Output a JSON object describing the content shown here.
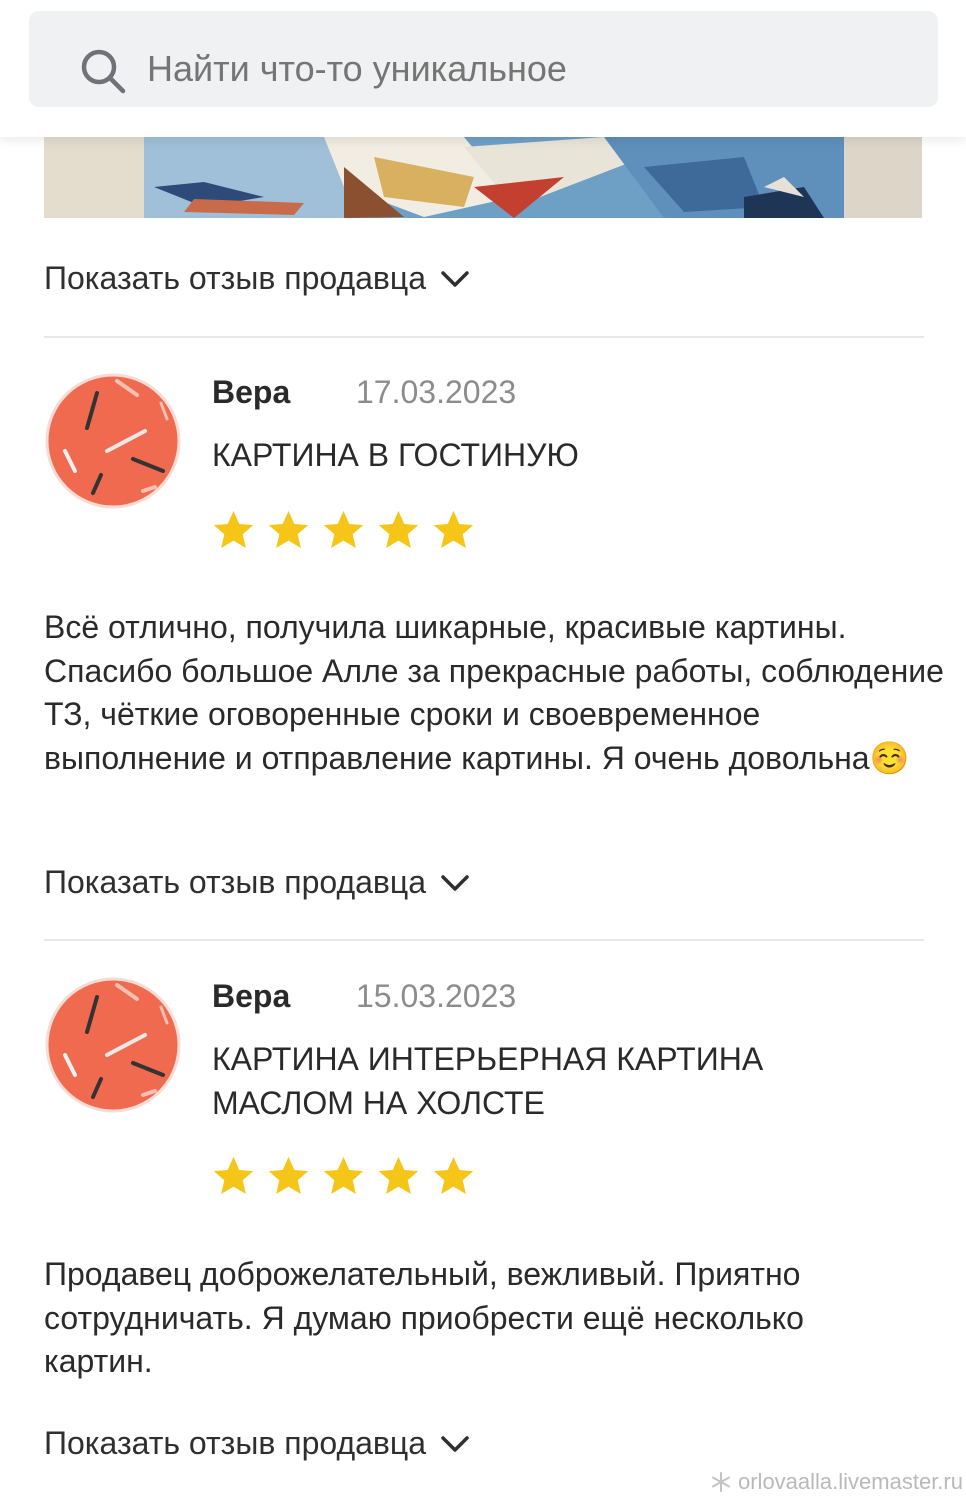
{
  "search": {
    "placeholder": "Найти что-то уникальное"
  },
  "show_seller_reply_label": "Показать отзыв продавца",
  "reviews": [
    {
      "author": "Вера",
      "date": "17.03.2023",
      "title": "КАРТИНА В ГОСТИНУЮ",
      "rating": 5,
      "text": "Всё отлично, получила шикарные, красивые картины. Спасибо большое Алле за прекрасные работы, соблюдение ТЗ, чёткие оговоренные сроки и своевременное выполнение и отправление картины. Я очень довольна☺️"
    },
    {
      "author": "Вера",
      "date": "15.03.2023",
      "title": "КАРТИНА ИНТЕРЬЕРНАЯ КАРТИНА МАСЛОМ НА ХОЛСТЕ",
      "rating": 5,
      "text": "Продавец доброжелательный, вежливый. Приятно сотрудничать. Я думаю приобрести ещё несколько картин."
    }
  ],
  "watermark": "orlovaalla.livemaster.ru",
  "colors": {
    "star": "#f5c518",
    "avatar": "#ef6a4f",
    "placeholder": "#7a7d80",
    "date": "#8c8c8c"
  }
}
